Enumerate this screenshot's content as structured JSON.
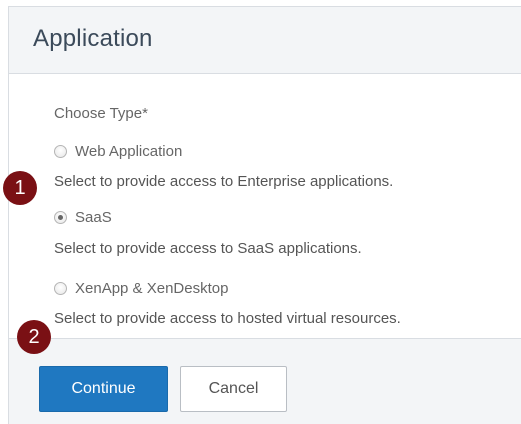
{
  "header": {
    "title": "Application"
  },
  "form": {
    "choose_type_label": "Choose Type*",
    "options": [
      {
        "label": "Web Application",
        "description": "Select to provide access to Enterprise applications.",
        "checked": false
      },
      {
        "label": "SaaS",
        "description": "Select to provide access to SaaS applications.",
        "checked": true
      },
      {
        "label": "XenApp & XenDesktop",
        "description": "Select to provide access to hosted virtual resources.",
        "checked": false
      }
    ]
  },
  "footer": {
    "continue_label": "Continue",
    "cancel_label": "Cancel"
  },
  "markers": [
    "1",
    "2"
  ],
  "colors": {
    "primary": "#1f78c1",
    "marker": "#7a1014",
    "header_bg": "#f3f5f7"
  }
}
